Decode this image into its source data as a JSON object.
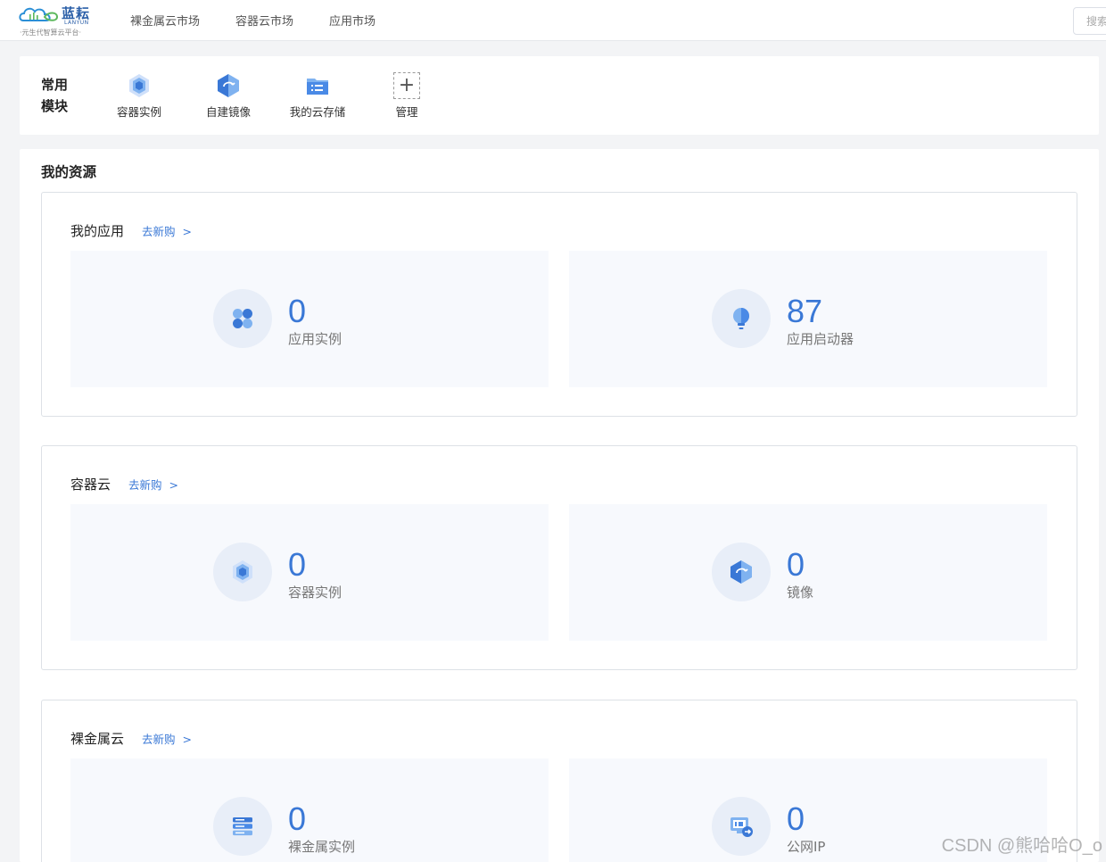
{
  "brand": {
    "name_cn": "蓝耘",
    "name_en": "LANYUN",
    "slogan": "·元生代智算云平台·"
  },
  "nav": {
    "items": [
      "裸金属云市场",
      "容器云市场",
      "应用市场"
    ]
  },
  "search": {
    "placeholder": "搜索"
  },
  "modules": {
    "title": "常用模块",
    "items": [
      {
        "label": "容器实例",
        "icon": "container-instance-icon"
      },
      {
        "label": "自建镜像",
        "icon": "custom-image-icon"
      },
      {
        "label": "我的云存储",
        "icon": "cloud-storage-icon"
      },
      {
        "label": "管理",
        "icon": "plus-icon"
      }
    ]
  },
  "resources": {
    "title": "我的资源",
    "sections": [
      {
        "title": "我的应用",
        "buy_label": "去新购",
        "chevron": ">",
        "stats": [
          {
            "value": "0",
            "label": "应用实例",
            "icon": "app-instance-icon"
          },
          {
            "value": "87",
            "label": "应用启动器",
            "icon": "lightbulb-icon"
          }
        ]
      },
      {
        "title": "容器云",
        "buy_label": "去新购",
        "chevron": ">",
        "stats": [
          {
            "value": "0",
            "label": "容器实例",
            "icon": "container-instance-icon"
          },
          {
            "value": "0",
            "label": "镜像",
            "icon": "image-icon"
          }
        ]
      },
      {
        "title": "裸金属云",
        "buy_label": "去新购",
        "chevron": ">",
        "stats": [
          {
            "value": "0",
            "label": "裸金属实例",
            "icon": "server-icon"
          },
          {
            "value": "0",
            "label": "公网IP",
            "icon": "public-ip-icon"
          }
        ]
      }
    ]
  },
  "watermark": "CSDN @熊哈哈O_o",
  "colors": {
    "accent": "#3a78d6",
    "icon_light": "#7fb2f0",
    "panel_bg": "#f7f9fd",
    "circle_bg": "#e8eef8"
  }
}
